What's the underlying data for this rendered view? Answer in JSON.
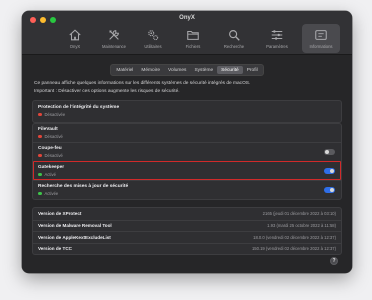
{
  "window": {
    "title": "OnyX"
  },
  "toolbar": {
    "items": [
      {
        "label": "OnyX",
        "icon": "house-icon",
        "active": false
      },
      {
        "label": "Maintenance",
        "icon": "tools-icon",
        "active": false
      },
      {
        "label": "Utilitaires",
        "icon": "gears-icon",
        "active": false
      },
      {
        "label": "Fichiers",
        "icon": "folder-icon",
        "active": false
      },
      {
        "label": "Recherche",
        "icon": "magnifier-icon",
        "active": false
      },
      {
        "label": "Paramètres",
        "icon": "sliders-icon",
        "active": false
      },
      {
        "label": "Informations",
        "icon": "info-icon",
        "active": true
      }
    ]
  },
  "tabs": [
    "Matériel",
    "Mémoire",
    "Volumes",
    "Système",
    "Sécurité",
    "Profil"
  ],
  "selected_tab": "Sécurité",
  "intro": {
    "line1": "Ce panneau affiche quelques informations sur les différents systèmes de sécurité intégrés de macOS.",
    "line2": "Important : Désactiver ces options augmente les risques de sécurité."
  },
  "integrity": {
    "title": "Protection de l'intégrité du système",
    "status": "Désactivée",
    "status_color": "#e0453a"
  },
  "security": [
    {
      "title": "FileVault",
      "status": "Désactivé",
      "status_color": "#e0453a",
      "toggle": null
    },
    {
      "title": "Coupe-feu",
      "status": "Désactivé",
      "status_color": "#e0453a",
      "toggle": "off"
    },
    {
      "title": "Gatekeeper",
      "status": "Activé",
      "status_color": "#3ec34a",
      "toggle": "on",
      "highlight": true
    },
    {
      "title": "Recherche des mises à jour de sécurité",
      "status": "Activée",
      "status_color": "#3ec34a",
      "toggle": "on"
    }
  ],
  "versions": [
    {
      "key": "Version de XProtect",
      "value": "2165 (jeudi 01 décembre 2022 à 03:10)"
    },
    {
      "key": "Version de Malware Removal Tool",
      "value": "1.93 (mardi 25 octobre 2022 à 11:58)"
    },
    {
      "key": "Version de AppleKextExcludeList",
      "value": "18.0.0 (vendredi 02 décembre 2022 à 12:37)"
    },
    {
      "key": "Version de TCC",
      "value": "150.19 (vendredi 02 décembre 2022 à 12:37)"
    }
  ],
  "help": {
    "label": "?"
  },
  "colors": {
    "accent": "#2f6ee8",
    "highlight_border": "#d02a2a"
  }
}
